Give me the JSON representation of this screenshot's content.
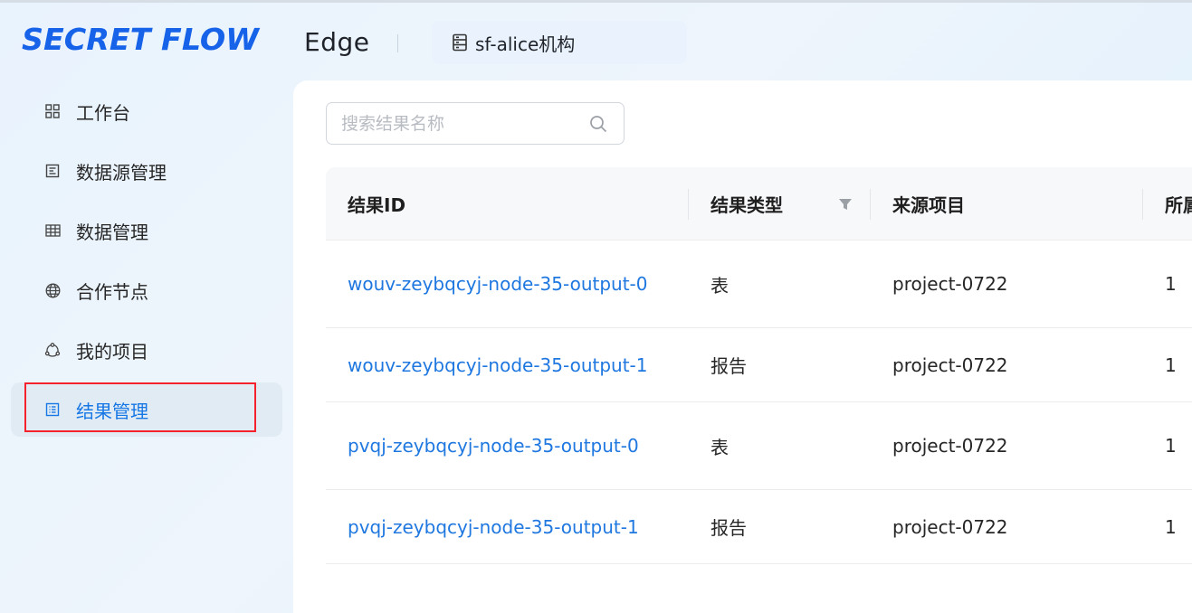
{
  "brand": {
    "logo_text": "SECRET FLOW",
    "brand_color": "#1662e8"
  },
  "header": {
    "app_title": "Edge",
    "org_name": "sf-alice机构",
    "org_icon": "database-icon"
  },
  "sidebar": {
    "active_index": 5,
    "items": [
      {
        "label": "工作台",
        "icon": "grid-icon"
      },
      {
        "label": "数据源管理",
        "icon": "datasource-icon"
      },
      {
        "label": "数据管理",
        "icon": "table-icon"
      },
      {
        "label": "合作节点",
        "icon": "globe-icon"
      },
      {
        "label": "我的项目",
        "icon": "project-icon"
      },
      {
        "label": "结果管理",
        "icon": "result-list-icon"
      }
    ]
  },
  "search": {
    "placeholder": "搜索结果名称",
    "value": ""
  },
  "table": {
    "columns": [
      "结果ID",
      "结果类型",
      "来源项目",
      "所属"
    ],
    "rows": [
      {
        "id": "wouv-zeybqcyj-node-35-output-0",
        "type": "表",
        "project": "project-0722",
        "owner": "1"
      },
      {
        "id": "wouv-zeybqcyj-node-35-output-1",
        "type": "报告",
        "project": "project-0722",
        "owner": "1"
      },
      {
        "id": "pvqj-zeybqcyj-node-35-output-0",
        "type": "表",
        "project": "project-0722",
        "owner": "1"
      },
      {
        "id": "pvqj-zeybqcyj-node-35-output-1",
        "type": "报告",
        "project": "project-0722",
        "owner": "1"
      }
    ]
  },
  "colors": {
    "accent": "#1677e5",
    "link": "#1f77e0",
    "highlight_border": "#f5222d"
  }
}
